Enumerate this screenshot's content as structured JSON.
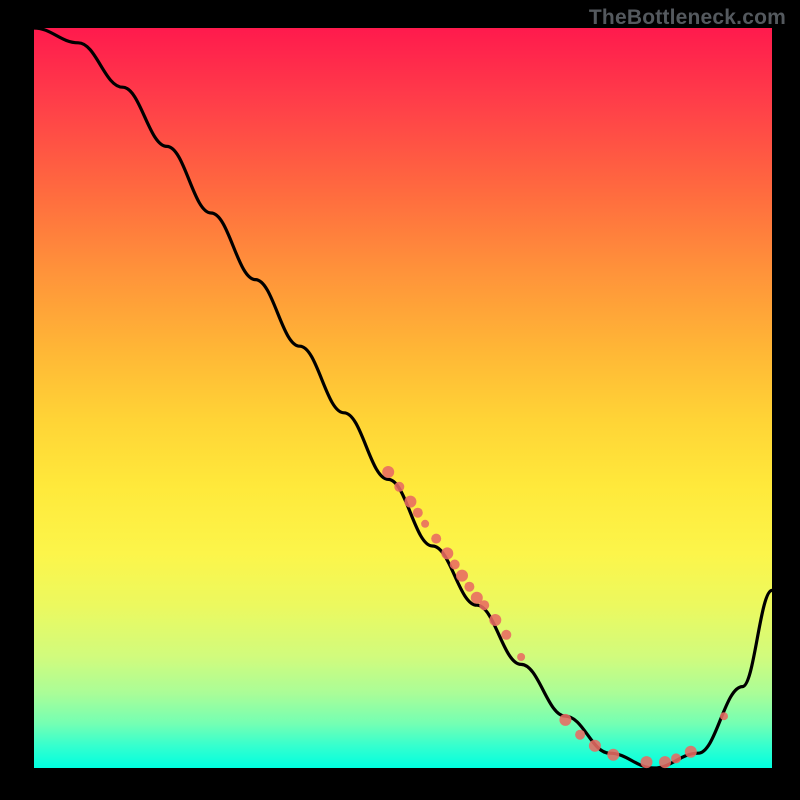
{
  "watermark": "TheBottleneck.com",
  "chart_data": {
    "type": "line",
    "title": "",
    "xlabel": "",
    "ylabel": "",
    "xlim": [
      0,
      100
    ],
    "ylim": [
      0,
      100
    ],
    "curve": {
      "x": [
        0,
        6,
        12,
        18,
        24,
        30,
        36,
        42,
        48,
        54,
        60,
        66,
        72,
        78,
        84,
        90,
        96,
        100
      ],
      "y": [
        100,
        98,
        92,
        84,
        75,
        66,
        57,
        48,
        39,
        30,
        22,
        14,
        7,
        2,
        0,
        2,
        11,
        24
      ]
    },
    "points": [
      {
        "x": 48,
        "y": 40,
        "r": 6
      },
      {
        "x": 49.5,
        "y": 38,
        "r": 5
      },
      {
        "x": 51,
        "y": 36,
        "r": 6
      },
      {
        "x": 52,
        "y": 34.5,
        "r": 5
      },
      {
        "x": 53,
        "y": 33,
        "r": 4
      },
      {
        "x": 54.5,
        "y": 31,
        "r": 5
      },
      {
        "x": 56,
        "y": 29,
        "r": 6
      },
      {
        "x": 57,
        "y": 27.5,
        "r": 5
      },
      {
        "x": 58,
        "y": 26,
        "r": 6
      },
      {
        "x": 59,
        "y": 24.5,
        "r": 5
      },
      {
        "x": 60,
        "y": 23,
        "r": 6
      },
      {
        "x": 61,
        "y": 22,
        "r": 5
      },
      {
        "x": 62.5,
        "y": 20,
        "r": 6
      },
      {
        "x": 64,
        "y": 18,
        "r": 5
      },
      {
        "x": 66,
        "y": 15,
        "r": 4
      },
      {
        "x": 72,
        "y": 6.5,
        "r": 6
      },
      {
        "x": 74,
        "y": 4.5,
        "r": 5
      },
      {
        "x": 76,
        "y": 3,
        "r": 6
      },
      {
        "x": 78.5,
        "y": 1.8,
        "r": 6
      },
      {
        "x": 83,
        "y": 0.8,
        "r": 6
      },
      {
        "x": 85.5,
        "y": 0.8,
        "r": 6
      },
      {
        "x": 87,
        "y": 1.3,
        "r": 5
      },
      {
        "x": 89,
        "y": 2.2,
        "r": 6
      },
      {
        "x": 93.5,
        "y": 7,
        "r": 4
      }
    ]
  }
}
